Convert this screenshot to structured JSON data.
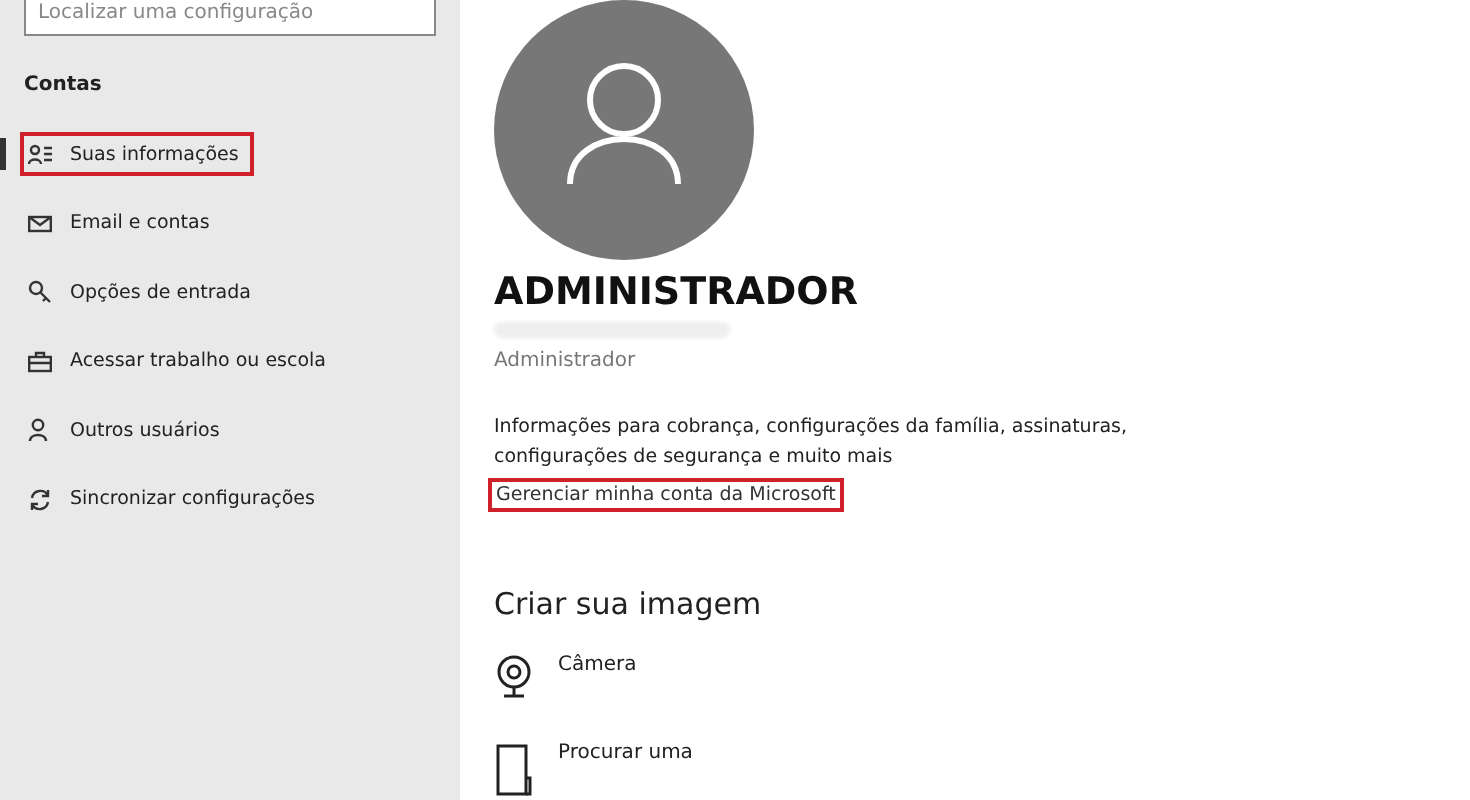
{
  "search": {
    "placeholder": "Localizar uma configuração"
  },
  "sidebar": {
    "heading": "Contas",
    "items": [
      {
        "label": "Suas informações",
        "selected": true,
        "highlighted": true
      },
      {
        "label": "Email e contas",
        "selected": false,
        "highlighted": false
      },
      {
        "label": "Opções de entrada",
        "selected": false,
        "highlighted": false
      },
      {
        "label": "Acessar trabalho ou escola",
        "selected": false,
        "highlighted": false
      },
      {
        "label": "Outros usuários",
        "selected": false,
        "highlighted": false
      },
      {
        "label": "Sincronizar configurações",
        "selected": false,
        "highlighted": false
      }
    ]
  },
  "profile": {
    "name": "ADMINISTRADOR",
    "role": "Administrador",
    "info": "Informações para cobrança, configurações da família, assinaturas, configurações de segurança e muito mais",
    "link": {
      "label": "Gerenciar minha conta da Microsoft",
      "highlighted": true
    }
  },
  "create_picture": {
    "heading": "Criar sua imagem",
    "options": [
      {
        "label": "Câmera"
      },
      {
        "label": "Procurar uma"
      }
    ]
  }
}
